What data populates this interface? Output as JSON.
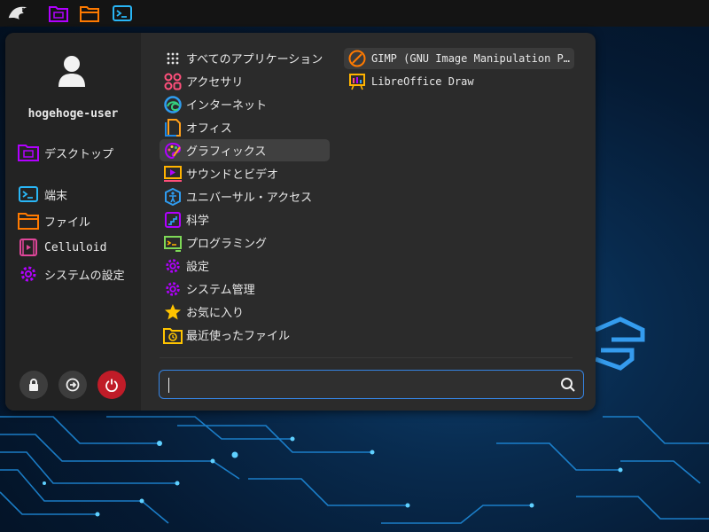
{
  "user": {
    "name": "hogehoge-user"
  },
  "sidebar": {
    "items": [
      {
        "label": "デスクトップ",
        "icon": "desktop-folder-icon"
      },
      {
        "label": "端末",
        "icon": "terminal-icon"
      },
      {
        "label": "ファイル",
        "icon": "files-icon"
      },
      {
        "label": "Celluloid",
        "icon": "video-player-icon"
      },
      {
        "label": "システムの設定",
        "icon": "settings-icon"
      }
    ],
    "actions": [
      {
        "icon": "lock-icon"
      },
      {
        "icon": "logout-icon"
      },
      {
        "icon": "power-icon"
      }
    ]
  },
  "categories": [
    {
      "label": "すべてのアプリケーション",
      "icon": "grid-icon"
    },
    {
      "label": "アクセサリ",
      "icon": "accessories-icon"
    },
    {
      "label": "インターネット",
      "icon": "internet-icon"
    },
    {
      "label": "オフィス",
      "icon": "office-icon"
    },
    {
      "label": "グラフィックス",
      "icon": "graphics-icon",
      "selected": true
    },
    {
      "label": "サウンドとビデオ",
      "icon": "multimedia-icon"
    },
    {
      "label": "ユニバーサル・アクセス",
      "icon": "accessibility-icon"
    },
    {
      "label": "科学",
      "icon": "science-icon"
    },
    {
      "label": "プログラミング",
      "icon": "programming-icon"
    },
    {
      "label": "設定",
      "icon": "settings-icon"
    },
    {
      "label": "システム管理",
      "icon": "system-admin-icon"
    },
    {
      "label": "お気に入り",
      "icon": "star-icon"
    },
    {
      "label": "最近使ったファイル",
      "icon": "recent-folder-icon"
    }
  ],
  "apps": [
    {
      "label": "GIMP (GNU Image Manipulation P…",
      "icon": "gimp-icon"
    },
    {
      "label": "LibreOffice Draw",
      "icon": "libreoffice-draw-icon"
    }
  ],
  "search": {
    "value": "",
    "placeholder": ""
  },
  "colors": {
    "accent": "#3584e4",
    "power": "#c01c28",
    "purple": "#b100ff",
    "orange": "#ff7a00",
    "panel": "#141414"
  }
}
